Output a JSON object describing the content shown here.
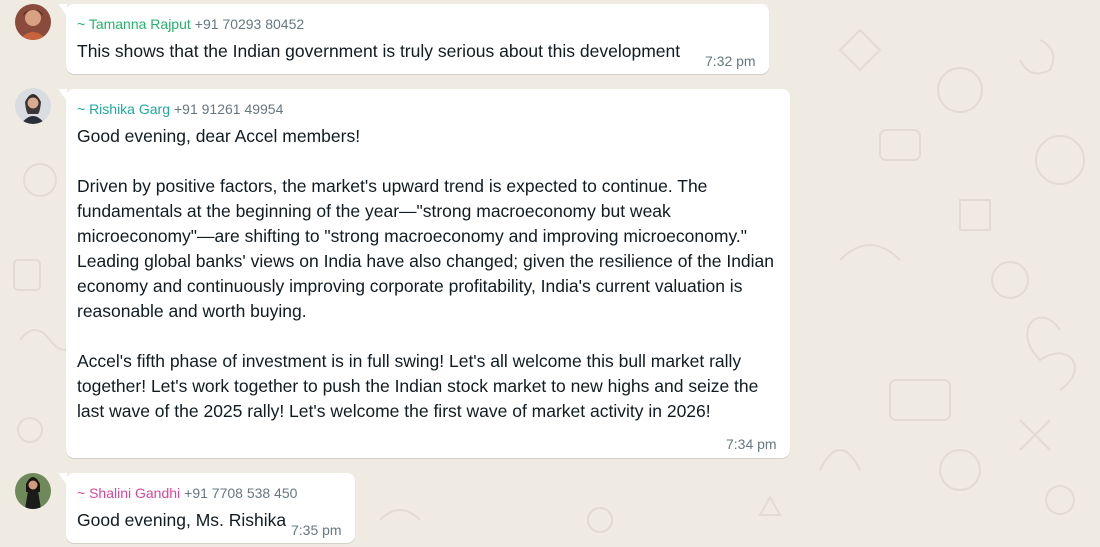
{
  "colors": {
    "background": "#efeae2",
    "bubble": "#ffffff",
    "name_tamanna": "#25b26b",
    "name_rishika": "#1fa89a",
    "name_shalini": "#d9479a"
  },
  "messages": [
    {
      "sender": "~ Tamanna Rajput",
      "phone": "+91 70293 80452",
      "text": "This shows that the Indian government is truly serious about this development",
      "time": "7:32 pm"
    },
    {
      "sender": "~ Rishika Garg",
      "phone": "+91 91261 49954",
      "text": "Good evening, dear Accel members!\n\nDriven by positive factors, the market's upward trend is expected to continue. The fundamentals at the beginning of the year—\"strong macroeconomy but weak microeconomy\"—are shifting to \"strong macroeconomy and improving microeconomy.\" Leading global banks' views on India have also changed; given the resilience of the Indian economy and continuously improving corporate profitability, India's current valuation is reasonable and worth buying.\n\nAccel's fifth phase of investment is in full swing! Let's all welcome this bull market rally together! Let's work together to push the Indian stock market to new highs and seize the last wave of the 2025 rally! Let's welcome the first wave of market activity in 2026!",
      "time": "7:34 pm"
    },
    {
      "sender": "~ Shalini Gandhi",
      "phone": "+91 7708 538 450",
      "text": "Good evening, Ms. Rishika",
      "time": "7:35 pm"
    }
  ]
}
